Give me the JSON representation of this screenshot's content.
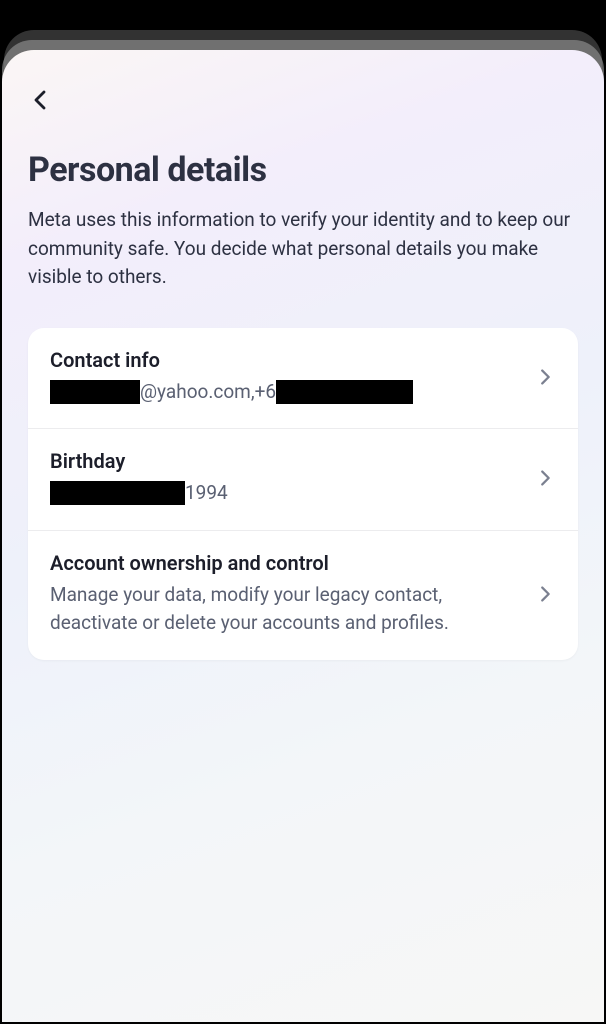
{
  "page": {
    "title": "Personal details",
    "subtitle": "Meta uses this information to verify your identity and to keep our community safe. You decide what personal details you make visible to others."
  },
  "items": {
    "contact": {
      "title": "Contact info",
      "email_suffix": "@yahoo.com, ",
      "phone_prefix": "+6"
    },
    "birthday": {
      "title": "Birthday",
      "year": " 1994"
    },
    "ownership": {
      "title": "Account ownership and control",
      "subtitle": "Manage your data, modify your legacy contact, deactivate or delete your accounts and profiles."
    }
  }
}
